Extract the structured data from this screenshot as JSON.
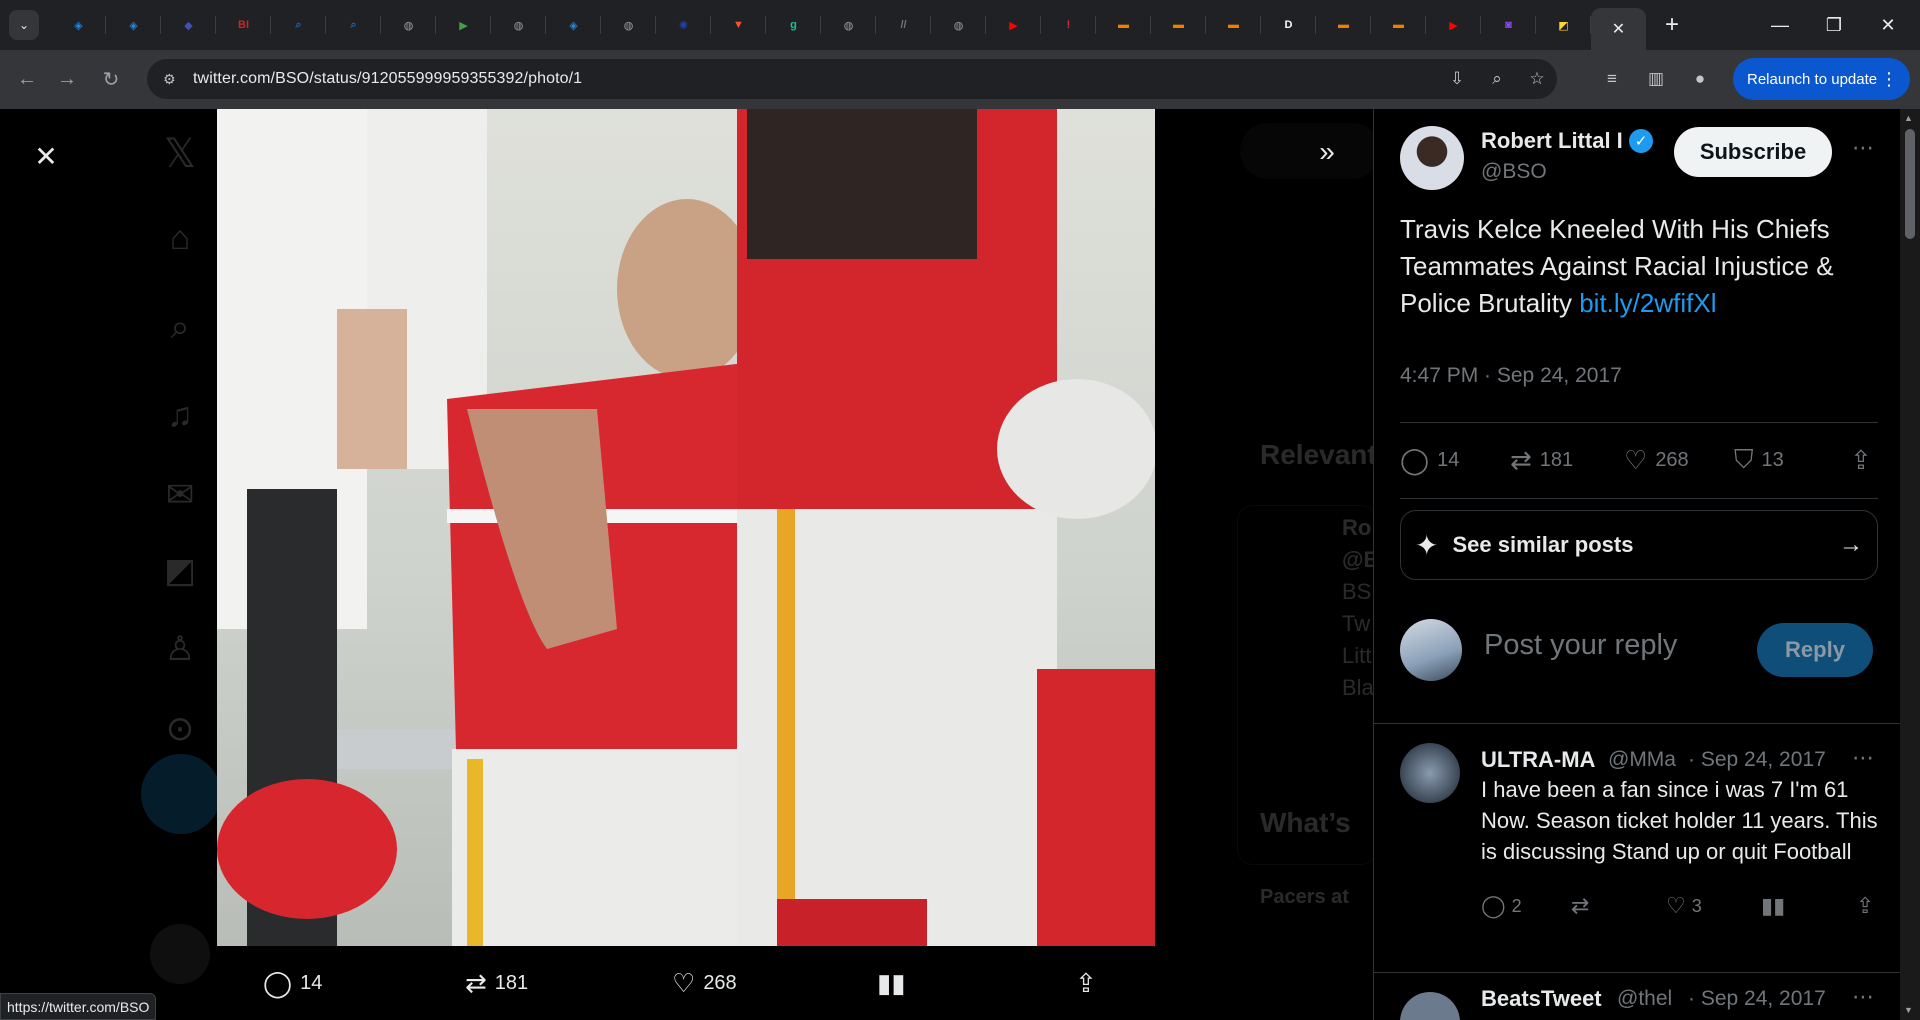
{
  "browser": {
    "tabs": [
      {
        "icon": "shield-icon",
        "color": "#1e88e5",
        "glyph": "◈"
      },
      {
        "icon": "shield-icon",
        "color": "#1e88e5",
        "glyph": "◈"
      },
      {
        "icon": "bookmark-arrow-icon",
        "color": "#3f51b5",
        "glyph": "◆"
      },
      {
        "icon": "bi-logo-icon",
        "color": "#c62828",
        "glyph": "BI"
      },
      {
        "icon": "search-icon",
        "color": "#1565c0",
        "glyph": "⌕"
      },
      {
        "icon": "search-icon",
        "color": "#1565c0",
        "glyph": "⌕"
      },
      {
        "icon": "globe-icon",
        "color": "#9e9e9e",
        "glyph": "◍"
      },
      {
        "icon": "play-icon",
        "color": "#43a047",
        "glyph": "▶"
      },
      {
        "icon": "globe-icon",
        "color": "#9e9e9e",
        "glyph": "◍"
      },
      {
        "icon": "shield-icon",
        "color": "#1e88e5",
        "glyph": "◈"
      },
      {
        "icon": "globe-icon",
        "color": "#9e9e9e",
        "glyph": "◍"
      },
      {
        "icon": "gear-icon",
        "color": "#1e40af",
        "glyph": "✺"
      },
      {
        "icon": "brave-shield-icon",
        "color": "#fb542b",
        "glyph": "▼"
      },
      {
        "icon": "g-logo-icon",
        "color": "#15c39a",
        "glyph": "g"
      },
      {
        "icon": "globe-icon",
        "color": "#9e9e9e",
        "glyph": "◍"
      },
      {
        "icon": "slash-logo-icon",
        "color": "#757575",
        "glyph": "//"
      },
      {
        "icon": "globe-icon",
        "color": "#9e9e9e",
        "glyph": "◍"
      },
      {
        "icon": "youtube-icon",
        "color": "#ff0000",
        "glyph": "▶"
      },
      {
        "icon": "red-logo-icon",
        "color": "#d32f2f",
        "glyph": "!"
      },
      {
        "icon": "bookmark-orange-icon",
        "color": "#f57c00",
        "glyph": "▬"
      },
      {
        "icon": "bookmark-orange-icon",
        "color": "#f57c00",
        "glyph": "▬"
      },
      {
        "icon": "bookmark-orange-icon",
        "color": "#f57c00",
        "glyph": "▬"
      },
      {
        "icon": "d-logo-icon",
        "color": "#fafafa",
        "glyph": "D"
      },
      {
        "icon": "bookmark-orange-icon",
        "color": "#f57c00",
        "glyph": "▬"
      },
      {
        "icon": "bookmark-orange-icon",
        "color": "#f57c00",
        "glyph": "▬"
      },
      {
        "icon": "youtube-icon",
        "color": "#ff0000",
        "glyph": "▶"
      },
      {
        "icon": "twitch-icon",
        "color": "#9146ff",
        "glyph": "◙"
      },
      {
        "icon": "yellow-logo-icon",
        "color": "#fdd835",
        "glyph": "◩"
      }
    ],
    "active_tab_close": "✕",
    "new_tab": "+",
    "url": "twitter.com/BSO/status/912055999959355392/photo/1",
    "relaunch_label": "Relaunch to update",
    "status_url": "https://twitter.com/BSO"
  },
  "photo_actions": {
    "replies": "14",
    "retweets": "181",
    "likes": "268"
  },
  "background": {
    "relevant_heading": "Relevant",
    "whats_heading": "What’s",
    "event_text": "Pacers at",
    "bg_lines": [
      "Ro",
      "@B",
      "BS",
      "Tw",
      "Litt",
      "Bla"
    ]
  },
  "tweet": {
    "author_name": "Robert Littal I",
    "author_handle": "@BSO",
    "subscribe_label": "Subscribe",
    "text": "Travis Kelce Kneeled With His Chiefs Teammates Against Racial Injustice & Police Brutality",
    "link": "bit.ly/2wfifXl",
    "timestamp": "4:47 PM · Sep 24, 2017",
    "stats": {
      "replies": "14",
      "retweets": "181",
      "likes": "268",
      "bookmarks": "13"
    },
    "similar_label": "See similar posts",
    "reply_placeholder": "Post your reply",
    "reply_button": "Reply",
    "accent": "#1d9bf0"
  },
  "replies": [
    {
      "name": "ULTRA-MA",
      "handle": "@MMa",
      "date": "· Sep 24, 2017",
      "text": "I have been a fan since i was 7 I'm 61 Now. Season ticket holder 11 years. This is discussing Stand up or quit Football",
      "replies": "2",
      "likes": "3"
    },
    {
      "name": "BeatsTweet",
      "handle": "@thel",
      "date": "· Sep 24, 2017"
    }
  ]
}
